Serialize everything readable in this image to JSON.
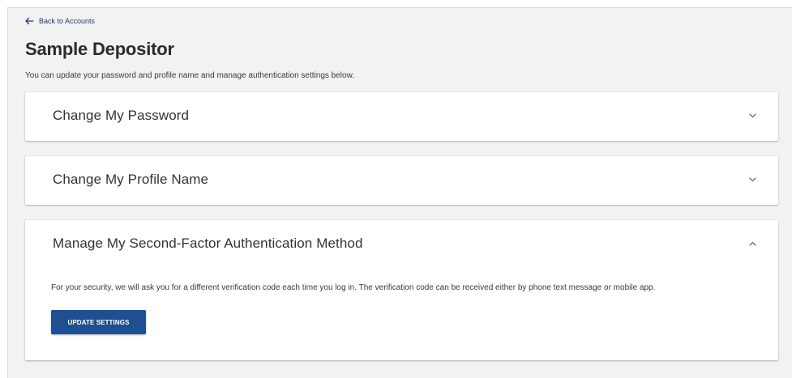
{
  "nav": {
    "back_label": "Back to Accounts"
  },
  "page": {
    "title": "Sample Depositor",
    "description": "You can update your password and profile name and manage authentication settings below."
  },
  "panels": [
    {
      "title": "Change My Password",
      "expanded": false,
      "icon": "chevron-down-icon"
    },
    {
      "title": "Change My Profile Name",
      "expanded": false,
      "icon": "chevron-down-icon"
    },
    {
      "title": "Manage My Second-Factor Authentication Method",
      "expanded": true,
      "icon": "chevron-up-icon",
      "body_text": "For your security, we will ask you for a different verification code each time you log in. The verification code can be received either by phone text message or mobile app.",
      "button_label": "UPDATE SETTINGS"
    }
  ],
  "colors": {
    "page_background": "#f2f2f2",
    "panel_background": "#ffffff",
    "primary_button": "#1f4f8f",
    "link": "#1f3f73"
  }
}
